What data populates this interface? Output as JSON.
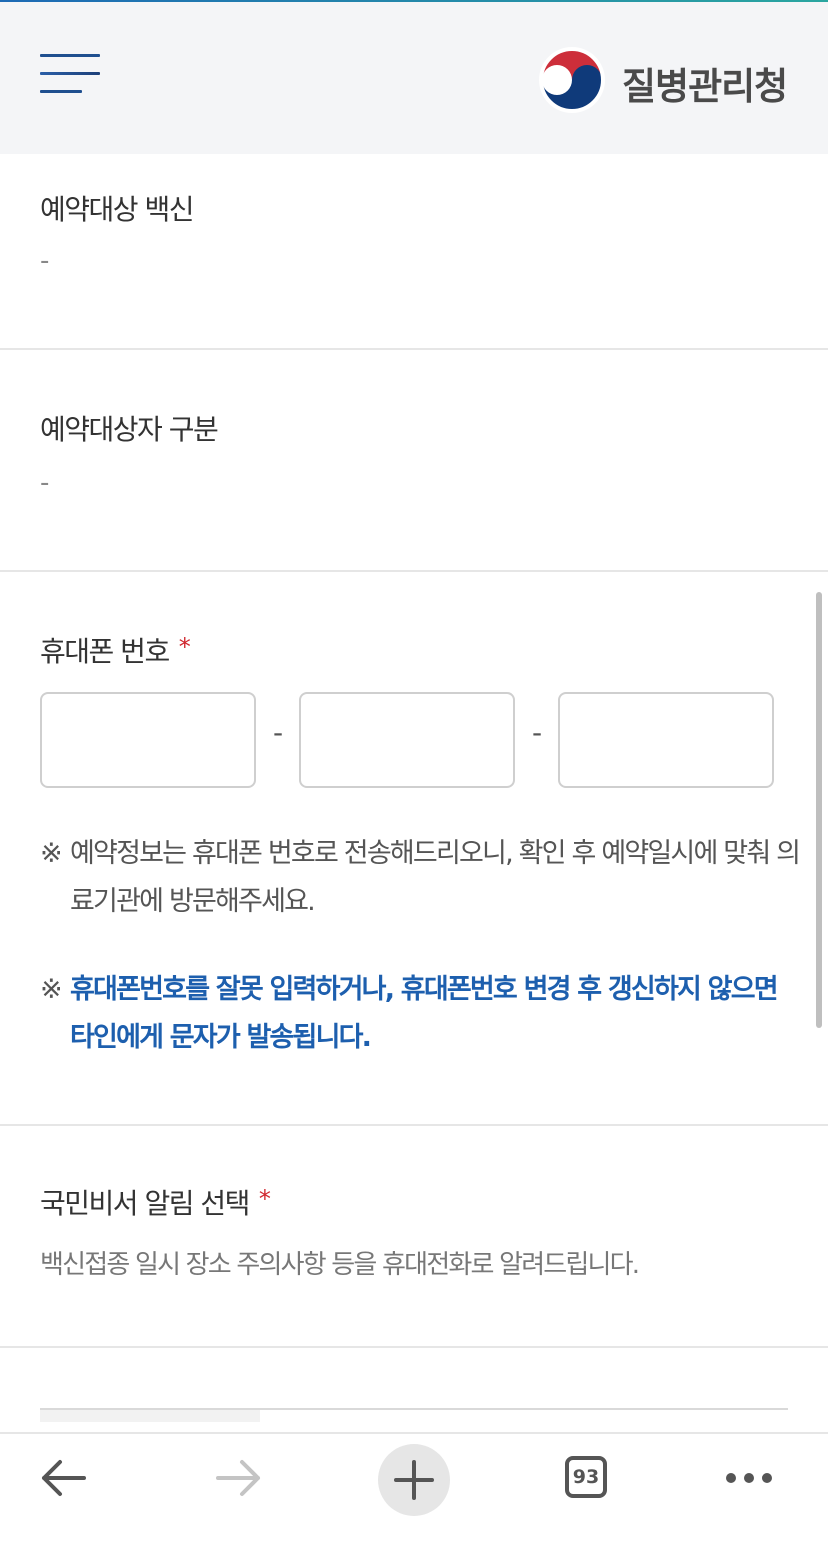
{
  "header": {
    "menu_icon": "hamburger-icon",
    "logo_text": "질병관리청",
    "logo_colors": {
      "red": "#cd2e3a",
      "blue": "#0f3a7a"
    }
  },
  "sections": {
    "vaccine": {
      "title": "예약대상 백신",
      "value": "-"
    },
    "target_type": {
      "title": "예약대상자 구분",
      "value": "-"
    },
    "phone": {
      "title": "휴대폰 번호",
      "required_mark": "*",
      "fields": [
        {
          "value": "",
          "placeholder": ""
        },
        {
          "value": "",
          "placeholder": ""
        },
        {
          "value": "",
          "placeholder": ""
        }
      ],
      "separator": "-",
      "note_mark": "※",
      "note": "예약정보는 휴대폰 번호로 전송해드리오니, 확인 후 예약일시에 맞춰 의료기관에 방문해주세요.",
      "warning": "휴대폰번호를 잘못 입력하거나, 휴대폰번호 변경 후 갱신하지 않으면 타인에게 문자가 발송됩니다."
    },
    "alert": {
      "title": "국민비서 알림 선택",
      "required_mark": "*",
      "description": "백신접종 일시 장소 주의사항 등을 휴대전화로 알려드립니다."
    }
  },
  "toolbar": {
    "back_icon": "arrow-left-icon",
    "forward_icon": "arrow-right-icon",
    "new_tab_icon": "plus-icon",
    "tab_count": "93",
    "more_icon": "more-dots-icon"
  },
  "colors": {
    "accent_blue": "#1d5fae",
    "required_red": "#d0262d"
  }
}
